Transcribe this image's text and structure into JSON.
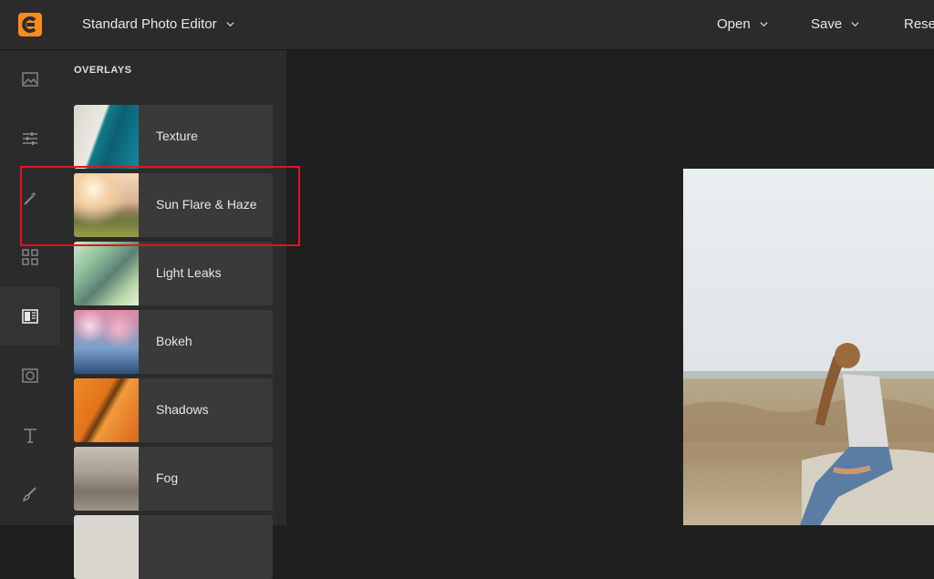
{
  "app": {
    "title": "Standard Photo Editor"
  },
  "menu": {
    "open": "Open",
    "save": "Save",
    "reset": "Reset"
  },
  "rail": {
    "items": [
      {
        "icon": "image-icon",
        "active": false
      },
      {
        "icon": "sliders-icon",
        "active": false
      },
      {
        "icon": "magic-wand-icon",
        "active": false
      },
      {
        "icon": "grid-icon",
        "active": false
      },
      {
        "icon": "overlay-icon",
        "active": true
      },
      {
        "icon": "frame-icon",
        "active": false
      },
      {
        "icon": "text-icon",
        "active": false
      },
      {
        "icon": "brush-icon",
        "active": false
      }
    ]
  },
  "panel": {
    "heading": "OVERLAYS",
    "items": [
      {
        "label": "Texture"
      },
      {
        "label": "Sun Flare & Haze"
      },
      {
        "label": "Light Leaks"
      },
      {
        "label": "Bokeh"
      },
      {
        "label": "Shadows"
      },
      {
        "label": "Fog"
      }
    ]
  },
  "colors": {
    "accent_logo": "#ff8a1c",
    "highlight": "#e4131d"
  }
}
